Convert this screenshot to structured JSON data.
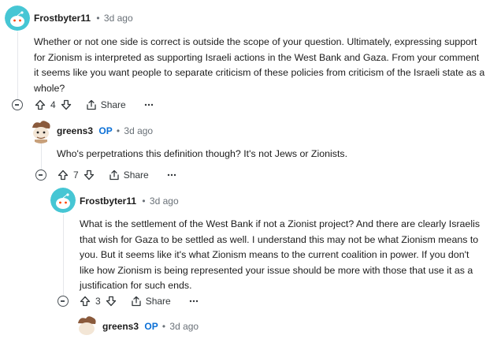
{
  "comments": [
    {
      "author": "Frostbyter11",
      "op_badge": "",
      "time": "3d ago",
      "lines": [
        "Whether or not one side is correct is outside the scope of your question. Ultimately, expressing support",
        "for Zionism is interpreted as supporting Israeli actions in the West Bank and Gaza. From your comment",
        "it seems like you want people to separate criticism of these policies from criticism of the Israeli state as a",
        "whole?"
      ],
      "votes": "4",
      "share_label": "Share",
      "avatar": "snoo-teal-avatar"
    },
    {
      "author": "greens3",
      "op_badge": "OP",
      "time": "3d ago",
      "lines": [
        "Who's perpetrations this definition though? It's not Jews or Zionists."
      ],
      "votes": "7",
      "share_label": "Share",
      "avatar": "snoo-brown-avatar"
    },
    {
      "author": "Frostbyter11",
      "op_badge": "",
      "time": "3d ago",
      "lines": [
        "What is the settlement of the West Bank if not a Zionist project? And there are clearly Israelis",
        "that wish for Gaza to be settled as well. I understand this may not be what Zionism means to",
        "you. But it seems like it's what Zionism means to the current coalition in power. If you don't",
        "like how Zionism is being represented your issue should be more with those that use it as a",
        "justification for such ends."
      ],
      "votes": "3",
      "share_label": "Share",
      "avatar": "snoo-teal-avatar"
    },
    {
      "author": "greens3",
      "op_badge": "OP",
      "time": "3d ago",
      "avatar": "snoo-brown-avatar"
    }
  ],
  "separator": "•",
  "colors": {
    "teal": "#3ec8d6",
    "brown": "#8a5a3c",
    "op": "#0a6fd6",
    "meta": "#6a7178"
  }
}
